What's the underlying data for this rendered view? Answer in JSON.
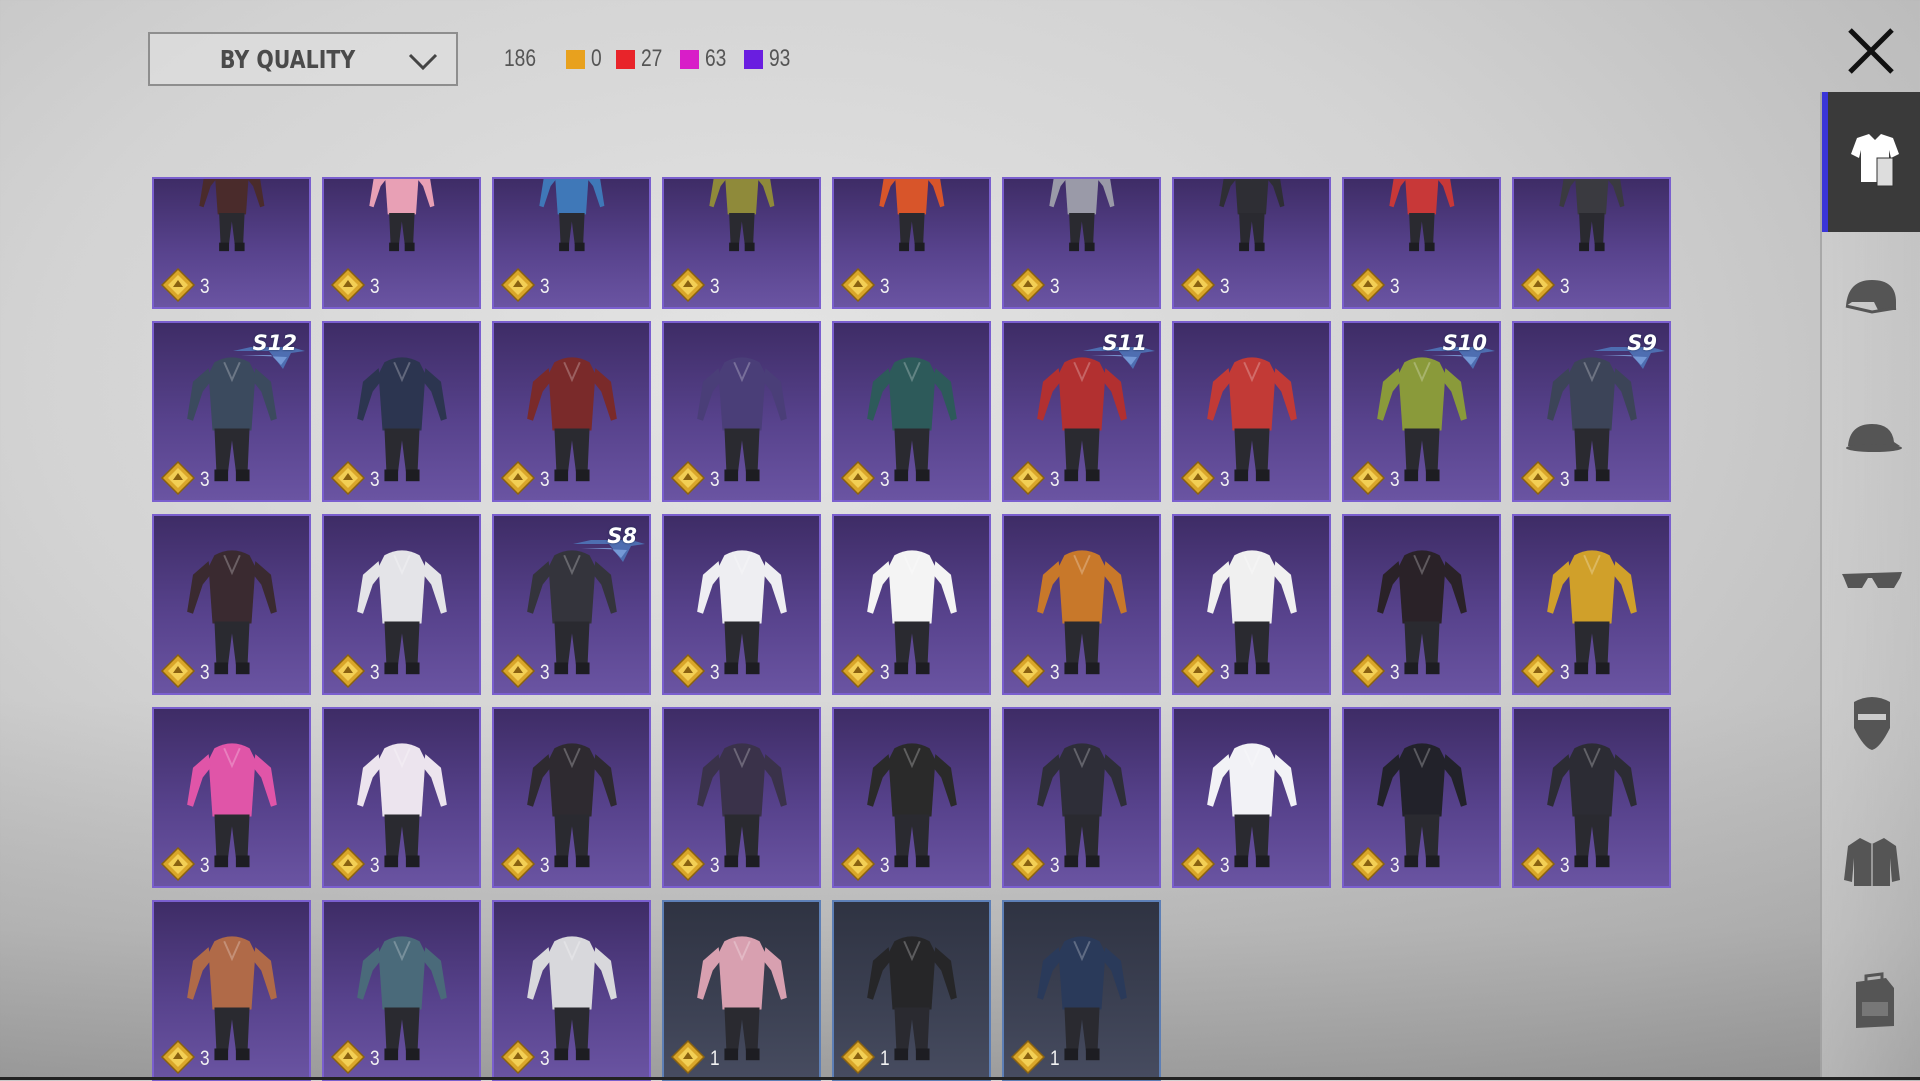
{
  "sort": {
    "label": "BY QUALITY"
  },
  "total_count": "186",
  "quality_stats": [
    {
      "color": "#e8a11e",
      "count": "0"
    },
    {
      "color": "#e8242a",
      "count": "27"
    },
    {
      "color": "#d81ec8",
      "count": "63"
    },
    {
      "color": "#6a1ee0",
      "count": "93"
    }
  ],
  "items": [
    {
      "q": "3",
      "rarity": "epic",
      "color": "#4a2b2b",
      "icon": "outfit-icon"
    },
    {
      "q": "3",
      "rarity": "epic",
      "color": "#e8a0b5",
      "icon": "outfit-icon"
    },
    {
      "q": "3",
      "rarity": "epic",
      "color": "#3f78b8",
      "icon": "outfit-icon"
    },
    {
      "q": "3",
      "rarity": "epic",
      "color": "#8f8a3a",
      "icon": "outfit-icon"
    },
    {
      "q": "3",
      "rarity": "epic",
      "color": "#d8552a",
      "icon": "outfit-icon"
    },
    {
      "q": "3",
      "rarity": "epic",
      "color": "#9a9aa8",
      "icon": "outfit-icon"
    },
    {
      "q": "3",
      "rarity": "epic",
      "color": "#2e2e34",
      "icon": "outfit-icon"
    },
    {
      "q": "3",
      "rarity": "epic",
      "color": "#c83838",
      "icon": "outfit-icon"
    },
    {
      "q": "3",
      "rarity": "epic",
      "color": "#3a3a40",
      "icon": "outfit-icon"
    },
    {
      "q": "3",
      "rarity": "epic",
      "color": "#3b4a5e",
      "season": "S12",
      "icon": "outfit-icon"
    },
    {
      "q": "3",
      "rarity": "epic",
      "color": "#2c3550",
      "icon": "outfit-icon"
    },
    {
      "q": "3",
      "rarity": "epic",
      "color": "#7a2a2a",
      "icon": "outfit-icon"
    },
    {
      "q": "3",
      "rarity": "epic",
      "color": "#4a3e78",
      "icon": "outfit-icon"
    },
    {
      "q": "3",
      "rarity": "epic",
      "color": "#2d5a5a",
      "icon": "outfit-icon"
    },
    {
      "q": "3",
      "rarity": "epic",
      "color": "#b23030",
      "season": "S11",
      "icon": "outfit-icon"
    },
    {
      "q": "3",
      "rarity": "epic",
      "color": "#c23a36",
      "icon": "outfit-icon"
    },
    {
      "q": "3",
      "rarity": "epic",
      "color": "#8a9a3a",
      "season": "S10",
      "icon": "outfit-icon"
    },
    {
      "q": "3",
      "rarity": "epic",
      "color": "#3c4458",
      "season": "S9",
      "icon": "outfit-icon"
    },
    {
      "q": "3",
      "rarity": "epic",
      "color": "#3a2a30",
      "icon": "outfit-icon"
    },
    {
      "q": "3",
      "rarity": "epic",
      "color": "#e4e4e8",
      "icon": "outfit-icon"
    },
    {
      "q": "3",
      "rarity": "epic",
      "color": "#34343c",
      "season": "S8",
      "icon": "outfit-icon"
    },
    {
      "q": "3",
      "rarity": "epic",
      "color": "#eeeef2",
      "icon": "outfit-icon"
    },
    {
      "q": "3",
      "rarity": "epic",
      "color": "#f4f4f4",
      "icon": "outfit-icon"
    },
    {
      "q": "3",
      "rarity": "epic",
      "color": "#c8782a",
      "icon": "outfit-icon"
    },
    {
      "q": "3",
      "rarity": "epic",
      "color": "#f0f0f0",
      "icon": "outfit-icon"
    },
    {
      "q": "3",
      "rarity": "epic",
      "color": "#2a2228",
      "icon": "outfit-icon"
    },
    {
      "q": "3",
      "rarity": "epic",
      "color": "#d0a02a",
      "icon": "outfit-icon"
    },
    {
      "q": "3",
      "rarity": "epic",
      "color": "#e055a8",
      "icon": "outfit-icon"
    },
    {
      "q": "3",
      "rarity": "epic",
      "color": "#ece4ee",
      "icon": "outfit-icon"
    },
    {
      "q": "3",
      "rarity": "epic",
      "color": "#2e2a30",
      "icon": "outfit-icon"
    },
    {
      "q": "3",
      "rarity": "epic",
      "color": "#3a324a",
      "icon": "outfit-icon"
    },
    {
      "q": "3",
      "rarity": "epic",
      "color": "#2a2a2a",
      "icon": "outfit-icon"
    },
    {
      "q": "3",
      "rarity": "epic",
      "color": "#2e2e38",
      "icon": "outfit-icon"
    },
    {
      "q": "3",
      "rarity": "epic",
      "color": "#f2f2f6",
      "icon": "outfit-icon"
    },
    {
      "q": "3",
      "rarity": "epic",
      "color": "#22222a",
      "icon": "outfit-icon"
    },
    {
      "q": "3",
      "rarity": "epic",
      "color": "#2c2c34",
      "icon": "outfit-icon"
    },
    {
      "q": "3",
      "rarity": "epic",
      "color": "#b06a48",
      "icon": "outfit-icon"
    },
    {
      "q": "3",
      "rarity": "epic",
      "color": "#4a6a7a",
      "icon": "outfit-icon"
    },
    {
      "q": "3",
      "rarity": "epic",
      "color": "#d8d8dc",
      "icon": "outfit-icon"
    },
    {
      "q": "1",
      "rarity": "common",
      "color": "#d8a0b0",
      "icon": "outfit-icon"
    },
    {
      "q": "1",
      "rarity": "common",
      "color": "#262628",
      "icon": "outfit-icon"
    },
    {
      "q": "1",
      "rarity": "common",
      "color": "#2a3a5a",
      "icon": "outfit-icon"
    }
  ],
  "categories": [
    {
      "icon": "outfit-icon",
      "active": true
    },
    {
      "icon": "helmet-icon",
      "active": false
    },
    {
      "icon": "cap-icon",
      "active": false
    },
    {
      "icon": "glasses-icon",
      "active": false
    },
    {
      "icon": "mask-icon",
      "active": false
    },
    {
      "icon": "jacket-icon",
      "active": false
    },
    {
      "icon": "backpack-icon",
      "active": false
    }
  ]
}
